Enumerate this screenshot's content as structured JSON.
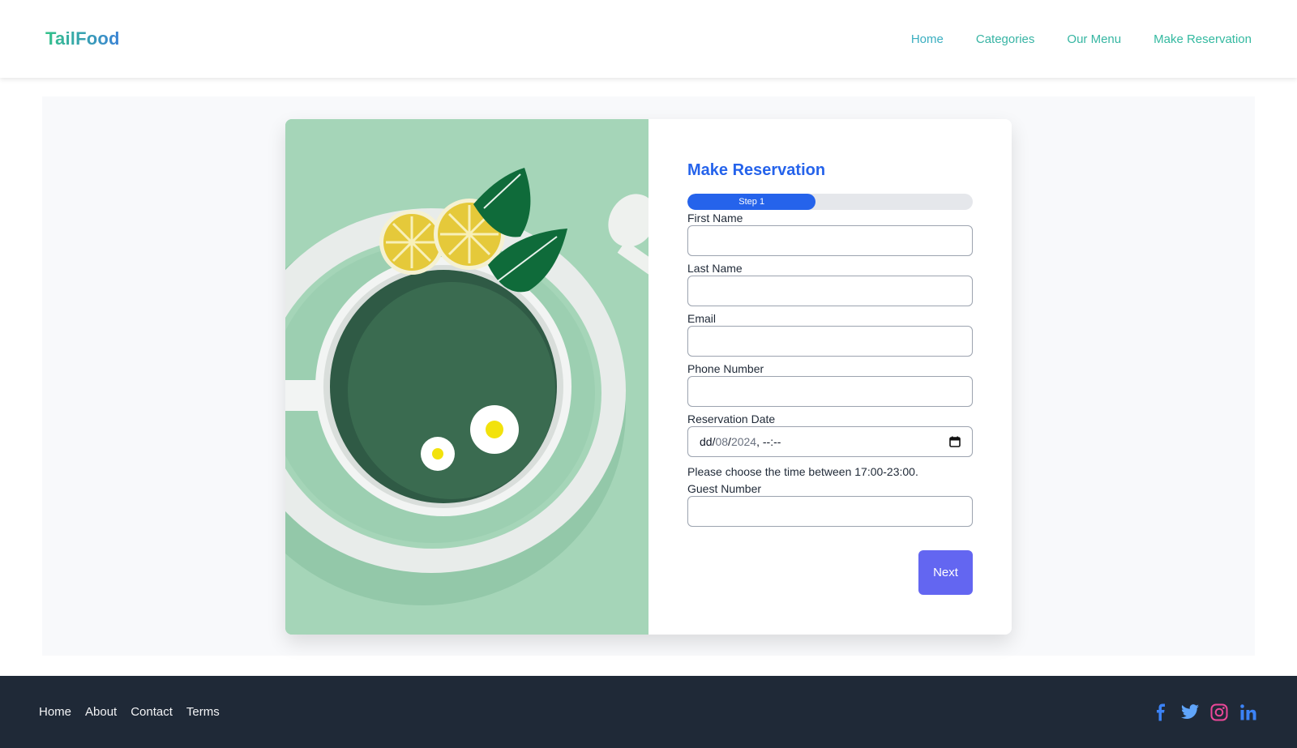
{
  "header": {
    "logo": "TailFood",
    "nav": [
      "Home",
      "Categories",
      "Our Menu",
      "Make Reservation"
    ]
  },
  "form": {
    "title": "Make Reservation",
    "progress": {
      "label": "Step 1",
      "fraction": 0.45
    },
    "fields": {
      "first_name": {
        "label": "First Name",
        "value": ""
      },
      "last_name": {
        "label": "Last Name",
        "value": ""
      },
      "email": {
        "label": "Email",
        "value": ""
      },
      "phone": {
        "label": "Phone Number",
        "value": ""
      },
      "date": {
        "label": "Reservation Date",
        "day": "dd",
        "month": "08",
        "year": "2024",
        "time": "--:--"
      },
      "guests": {
        "label": "Guest Number",
        "value": ""
      }
    },
    "hint": "Please choose the time between 17:00-23:00.",
    "next_label": "Next"
  },
  "footer": {
    "links": [
      "Home",
      "About",
      "Contact",
      "Terms"
    ],
    "socials": [
      "facebook-icon",
      "twitter-icon",
      "instagram-icon",
      "linkedin-icon"
    ]
  },
  "colors": {
    "brand_blue": "#2563eb",
    "button": "#6366f1",
    "footer_bg": "#1f2937",
    "nav_text": "#38b4a4",
    "art_bg": "#a5d5b8"
  }
}
